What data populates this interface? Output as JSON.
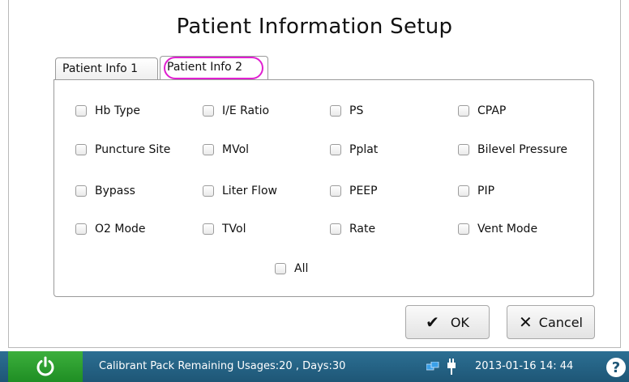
{
  "title": "Patient Information Setup",
  "tabs": [
    "Patient Info 1",
    "Patient Info 2"
  ],
  "checkboxes": [
    [
      "Hb Type",
      "I/E Ratio",
      "PS",
      "CPAP"
    ],
    [
      "Puncture Site",
      "MVol",
      "Pplat",
      "Bilevel Pressure"
    ],
    [
      "Bypass",
      "Liter Flow",
      "PEEP",
      "PIP"
    ],
    [
      "O2 Mode",
      "TVol",
      "Rate",
      "Vent Mode"
    ]
  ],
  "all_label": "All",
  "buttons": {
    "ok": "OK",
    "cancel": "Cancel"
  },
  "status": {
    "message": "Calibrant Pack Remaining Usages:20 , Days:30",
    "datetime": "2013-01-16  14: 44"
  },
  "colors": {
    "highlight_ring": "#e020d0",
    "statusbar": "#1e5676",
    "power": "#2a9e2e"
  }
}
